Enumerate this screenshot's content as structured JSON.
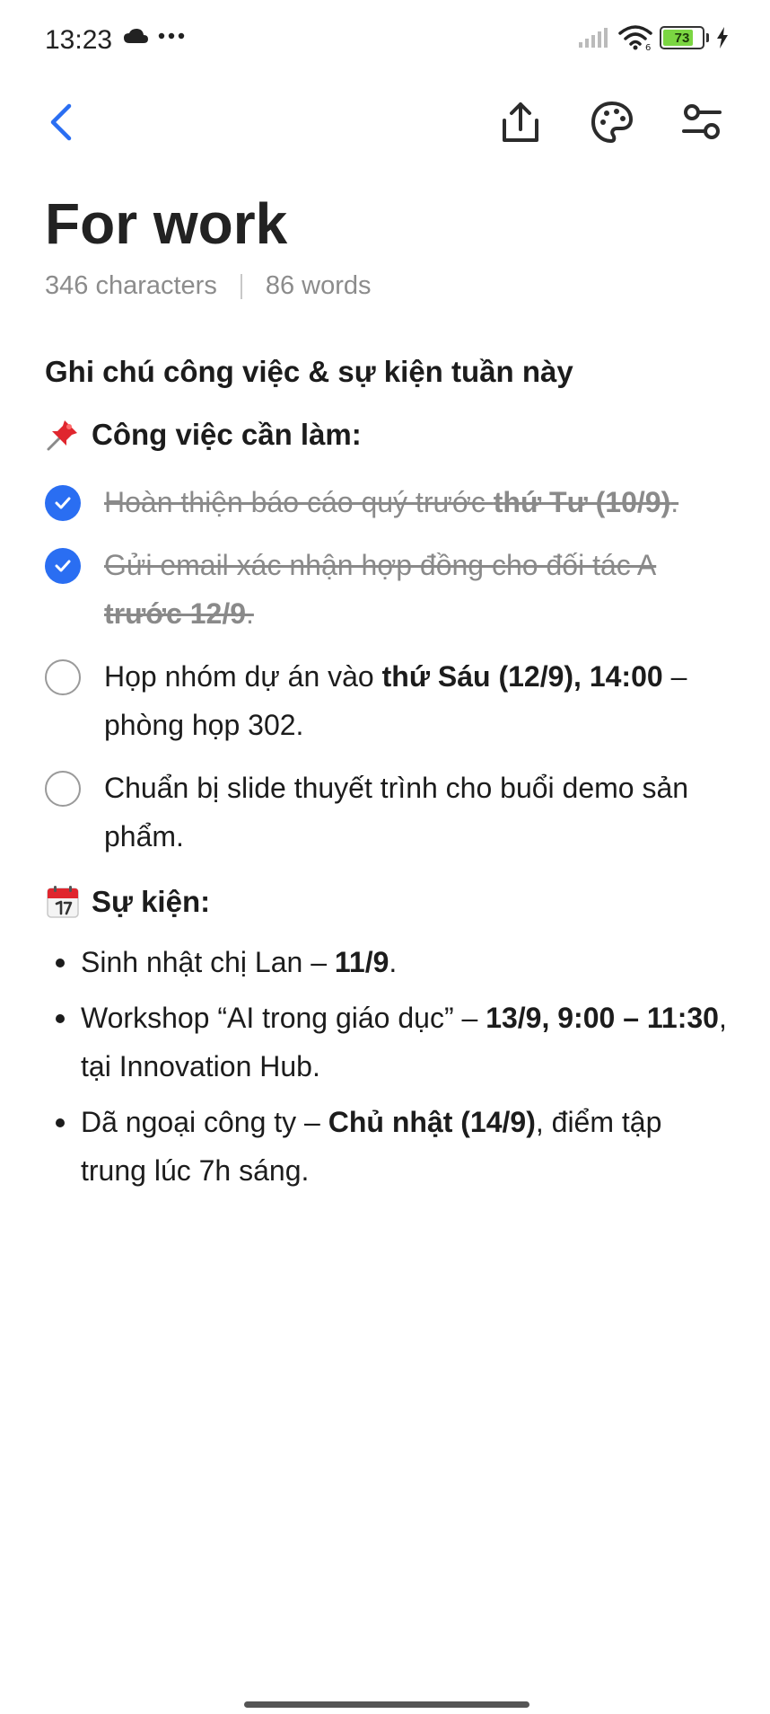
{
  "status_bar": {
    "time": "13:23",
    "battery_level": 73,
    "battery_text": "73",
    "icons": [
      "cloud-icon",
      "more-dots-icon",
      "signal-icon",
      "wifi-icon",
      "battery-icon",
      "charging-bolt-icon"
    ]
  },
  "toolbar": {
    "icons": [
      "back-chevron-icon",
      "share-icon",
      "palette-icon",
      "settings-sliders-icon"
    ],
    "accent_color": "#2a6ef2"
  },
  "note": {
    "title": "For work",
    "char_count": "346 characters",
    "word_count": "86 words",
    "heading": "Ghi chú công việc & sự kiện tuần này",
    "tasks_heading": "Công việc cần làm:",
    "tasks": [
      {
        "checked": true,
        "text": "Hoàn thiện báo cáo quý trước ",
        "bold": "thứ Tư (10/9)",
        "after": "."
      },
      {
        "checked": true,
        "text": "Gửi email xác nhận hợp đồng cho đối tác A ",
        "bold": "trước 12/9",
        "after": "."
      },
      {
        "checked": false,
        "text": "Họp nhóm dự án vào ",
        "bold": "thứ Sáu (12/9), 14:00",
        "after": " – phòng họp 302."
      },
      {
        "checked": false,
        "text": "Chuẩn bị slide thuyết trình cho buổi demo sản phẩm.",
        "bold": "",
        "after": ""
      }
    ],
    "events_heading": "Sự kiện:",
    "events": [
      {
        "text": "Sinh nhật chị Lan – ",
        "bold": "11/9",
        "after": "."
      },
      {
        "text": "Workshop “AI trong giáo dục” – ",
        "bold": "13/9, 9:00 – 11:30",
        "after": ", tại Innovation Hub."
      },
      {
        "text": "Dã ngoại công ty – ",
        "bold": "Chủ nhật (14/9)",
        "after": ", điểm tập trung lúc 7h sáng."
      }
    ]
  }
}
